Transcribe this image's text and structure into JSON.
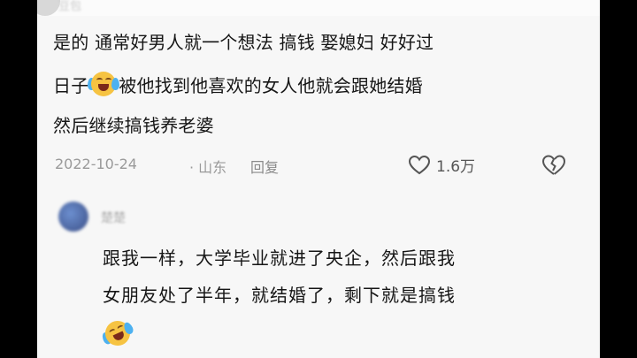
{
  "comment1": {
    "username": "豆包",
    "line1": "是的 通常好男人就一个想法 搞钱 娶媳妇 好好过",
    "line2_before": "日子",
    "line2_after": "被他找到他喜欢的女人他就会跟她结婚",
    "line3": "然后继续搞钱养老婆",
    "date": "2022-10-24",
    "location": "· 山东",
    "reply_label": "回复",
    "like_count": "1.6万",
    "emoji": "crying-laughing-emoji"
  },
  "comment2": {
    "username": "楚楚",
    "line1": "跟我一样，大学毕业就进了央企，然后跟我",
    "line2": "女朋友处了半年，就结婚了，剩下就是搞钱",
    "emoji": "rolling-laughing-emoji"
  },
  "colors": {
    "background": "#f7f7f7",
    "text": "#161616",
    "meta": "#9a9a9a"
  }
}
